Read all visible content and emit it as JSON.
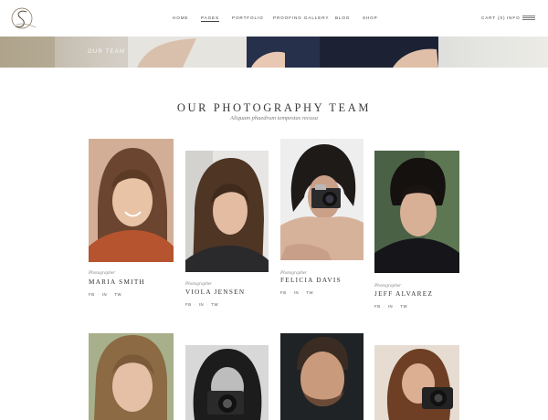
{
  "nav": {
    "items": [
      "HOME",
      "PAGES",
      "PORTFOLIO",
      "PROOFING GALLERY",
      "BLOG",
      "SHOP"
    ],
    "active": "PAGES",
    "cart": "CART (0)",
    "info": "INFO"
  },
  "hero": {
    "text": "OUR TEAM"
  },
  "section": {
    "title": "OUR PHOTOGRAPHY TEAM",
    "subtitle": "Aliquam phaedrum tempestas recusa"
  },
  "social_labels": [
    "FB",
    "IN",
    "TW"
  ],
  "members": [
    {
      "role": "Photographer",
      "name": "MARIA SMITH"
    },
    {
      "role": "Photographer",
      "name": "VIOLA JENSEN"
    },
    {
      "role": "Photographer",
      "name": "FELICIA DAVIS"
    },
    {
      "role": "Photographer",
      "name": "JEFF ALVAREZ"
    }
  ],
  "colors": {
    "text": "#333333",
    "muted": "#888888",
    "background": "#ffffff"
  }
}
